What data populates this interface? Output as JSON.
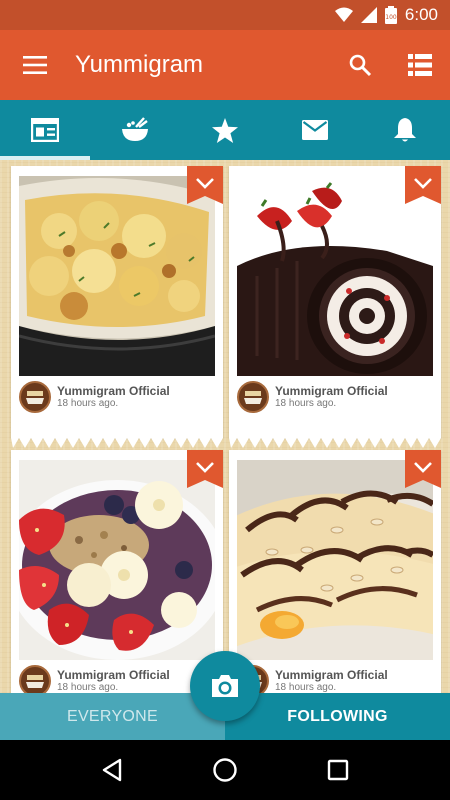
{
  "status_bar": {
    "time": "6:00",
    "battery": "100"
  },
  "app": {
    "title": "Yummigram"
  },
  "tabs": [
    {
      "icon": "feed-icon",
      "active": true
    },
    {
      "icon": "bowl-icon",
      "active": false
    },
    {
      "icon": "star-icon",
      "active": false
    },
    {
      "icon": "mail-icon",
      "active": false
    },
    {
      "icon": "bell-icon",
      "active": false
    }
  ],
  "posts": [
    {
      "author": "Yummigram Official",
      "time": "18 hours ago.",
      "photo": "baked-cauliflower-gratin"
    },
    {
      "author": "Yummigram Official",
      "time": "18 hours ago.",
      "photo": "chocolate-swiss-roll"
    },
    {
      "author": "Yummigram Official",
      "time": "18 hours ago.",
      "photo": "fruit-granola-bowl"
    },
    {
      "author": "Yummigram Official",
      "time": "18 hours ago.",
      "photo": "chocolate-crepes"
    }
  ],
  "toggle": {
    "everyone": "EVERYONE",
    "following": "FOLLOWING",
    "selected": "following"
  },
  "colors": {
    "primary": "#e0582f",
    "status": "#c2502b",
    "accent": "#0f8a9e",
    "background": "#ead7ab"
  }
}
